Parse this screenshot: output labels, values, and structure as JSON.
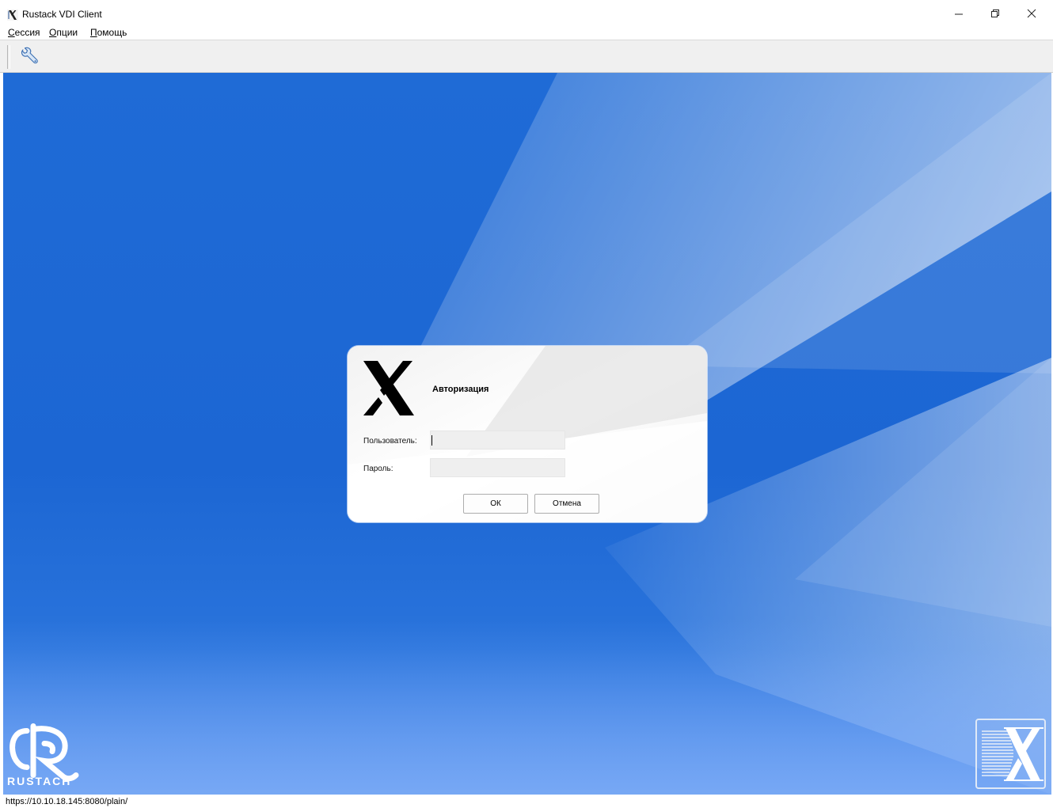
{
  "window": {
    "title": "Rustack VDI Client",
    "icon": "x-logo-icon"
  },
  "menu": {
    "items": [
      {
        "label": "Сессия",
        "underline": "С",
        "rest": "ессия"
      },
      {
        "label": "Опции",
        "underline": "О",
        "rest": "пции"
      },
      {
        "label": "Помощь",
        "underline": "П",
        "rest": "омощь"
      }
    ]
  },
  "toolbar": {
    "settings_icon": "wrench-icon"
  },
  "dialog": {
    "title": "Авторизация",
    "user_label": "Пользователь:",
    "user_value": "",
    "password_label": "Пароль:",
    "password_value": "",
    "ok_label": "ОК",
    "cancel_label": "Отмена"
  },
  "branding": {
    "rustack_text": "RUSTACH"
  },
  "status": {
    "url": "https://10.10.18.145:8080/plain/"
  },
  "colors": {
    "desktop_blue": "#1f6bd6",
    "accent_light": "#5a93ef"
  }
}
